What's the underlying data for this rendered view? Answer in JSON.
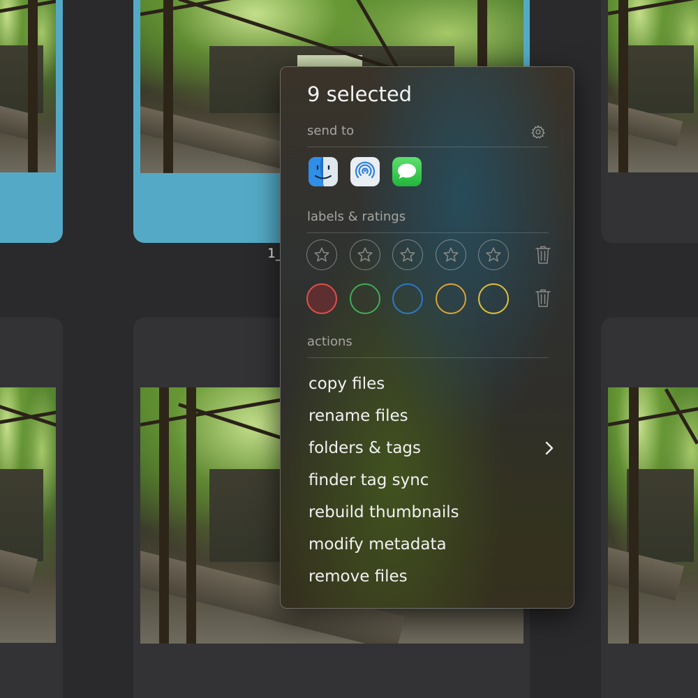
{
  "grid": {
    "caption": "1_"
  },
  "popup": {
    "title": "9 selected",
    "send_to": {
      "label": "send to",
      "settings_icon": "gear-icon",
      "apps": [
        {
          "name": "finder-icon",
          "color": "#3b8fe8"
        },
        {
          "name": "airdrop-icon",
          "color": "#2b7fe0"
        },
        {
          "name": "messages-icon",
          "color": "#2fc64a"
        }
      ]
    },
    "labels_ratings": {
      "label": "labels & ratings",
      "star_count": 5,
      "star_icon": "star-icon",
      "clear_icon": "trash-icon",
      "colors": [
        {
          "name": "red",
          "border": "#e0504d",
          "fill": "#5d2f30"
        },
        {
          "name": "green",
          "border": "#3fae58",
          "fill": "transparent"
        },
        {
          "name": "blue",
          "border": "#2f78c8",
          "fill": "transparent"
        },
        {
          "name": "orange",
          "border": "#e0a334",
          "fill": "transparent"
        },
        {
          "name": "yellow",
          "border": "#e2c33a",
          "fill": "transparent"
        }
      ]
    },
    "actions": {
      "label": "actions",
      "items": [
        {
          "label": "copy files"
        },
        {
          "label": "rename files"
        },
        {
          "label": "folders & tags",
          "submenu": true
        },
        {
          "label": "finder tag sync"
        },
        {
          "label": "rebuild thumbnails"
        },
        {
          "label": "modify metadata"
        },
        {
          "label": "remove files"
        }
      ],
      "submenu_icon": "chevron-right-icon"
    }
  }
}
